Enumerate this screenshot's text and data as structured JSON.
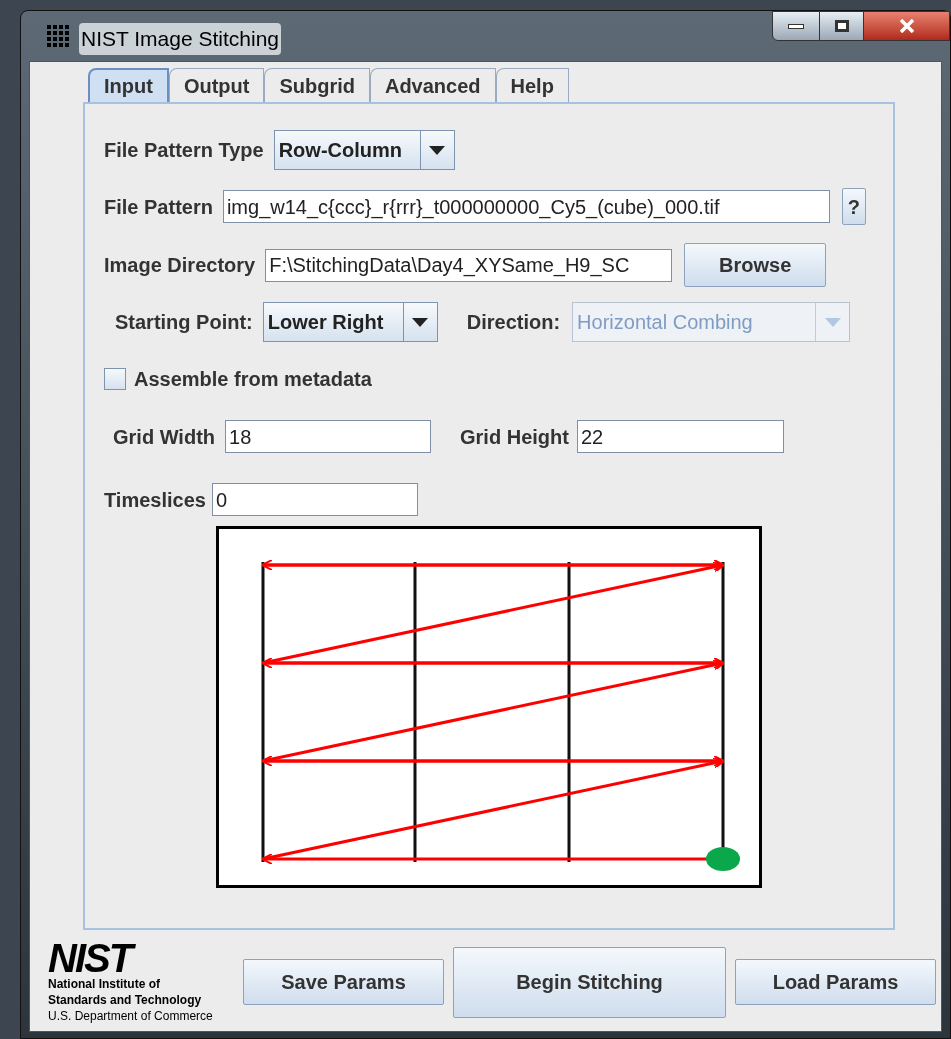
{
  "window": {
    "title": "NIST Image Stitching"
  },
  "tabs": [
    {
      "label": "Input",
      "selected": true
    },
    {
      "label": "Output",
      "selected": false
    },
    {
      "label": "Subgrid",
      "selected": false
    },
    {
      "label": "Advanced",
      "selected": false
    },
    {
      "label": "Help",
      "selected": false
    }
  ],
  "file_pattern_type": {
    "label": "File Pattern Type",
    "value": "Row-Column",
    "disabled": false
  },
  "file_pattern": {
    "label": "File Pattern",
    "value": "img_w14_c{ccc}_r{rrr}_t000000000_Cy5_(cube)_000.tif",
    "help_button": "?"
  },
  "image_directory": {
    "label": "Image Directory",
    "value": "F:\\StitchingData\\Day4_XYSame_H9_SC",
    "button": "Browse"
  },
  "starting_point": {
    "label": "Starting Point:",
    "value": "Lower Right",
    "disabled": false
  },
  "direction": {
    "label": "Direction:",
    "value": "Horizontal Combing",
    "disabled": true
  },
  "assemble_from_metadata": {
    "label": "Assemble from metadata",
    "checked": false
  },
  "grid_width": {
    "label": "Grid Width",
    "value": "18"
  },
  "grid_height": {
    "label": "Grid Height",
    "value": "22"
  },
  "timeslices": {
    "label": "Timeslices",
    "value": "0"
  },
  "logo": {
    "mark": "NIST",
    "lines": [
      "National Institute of",
      "Standards and Technology",
      "U.S. Department of Commerce"
    ]
  },
  "buttons": [
    "Save Params",
    "Begin Stitching",
    "Load Params"
  ]
}
